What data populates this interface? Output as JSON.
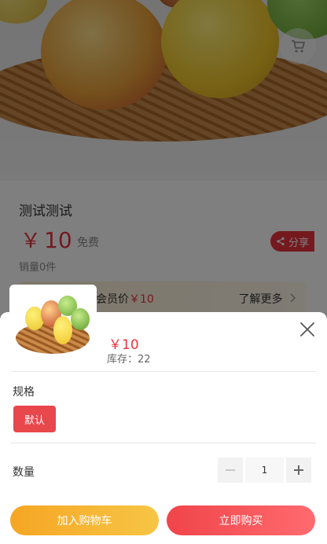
{
  "product": {
    "title": "测试测试",
    "currency": "￥",
    "price": "10",
    "freight": "免费",
    "sales": "销量0件",
    "share_label": "分享",
    "member_price_label": "会员价",
    "member_price": "￥10",
    "learn_more": "了解更多"
  },
  "sheet": {
    "price": "￥10",
    "stock": "库存：22",
    "spec_label": "规格",
    "spec_options": [
      "默认"
    ],
    "quantity_label": "数量",
    "quantity": "1",
    "add_to_cart": "加入购物车",
    "buy_now": "立即购买"
  },
  "icons": {
    "cart": "cart-icon",
    "share": "share-icon",
    "close": "close-icon",
    "chevron": "chevron-right-icon"
  },
  "colors": {
    "accent": "#e8343f",
    "cart_button": "#f5a623",
    "buy_button": "#f0444a"
  }
}
